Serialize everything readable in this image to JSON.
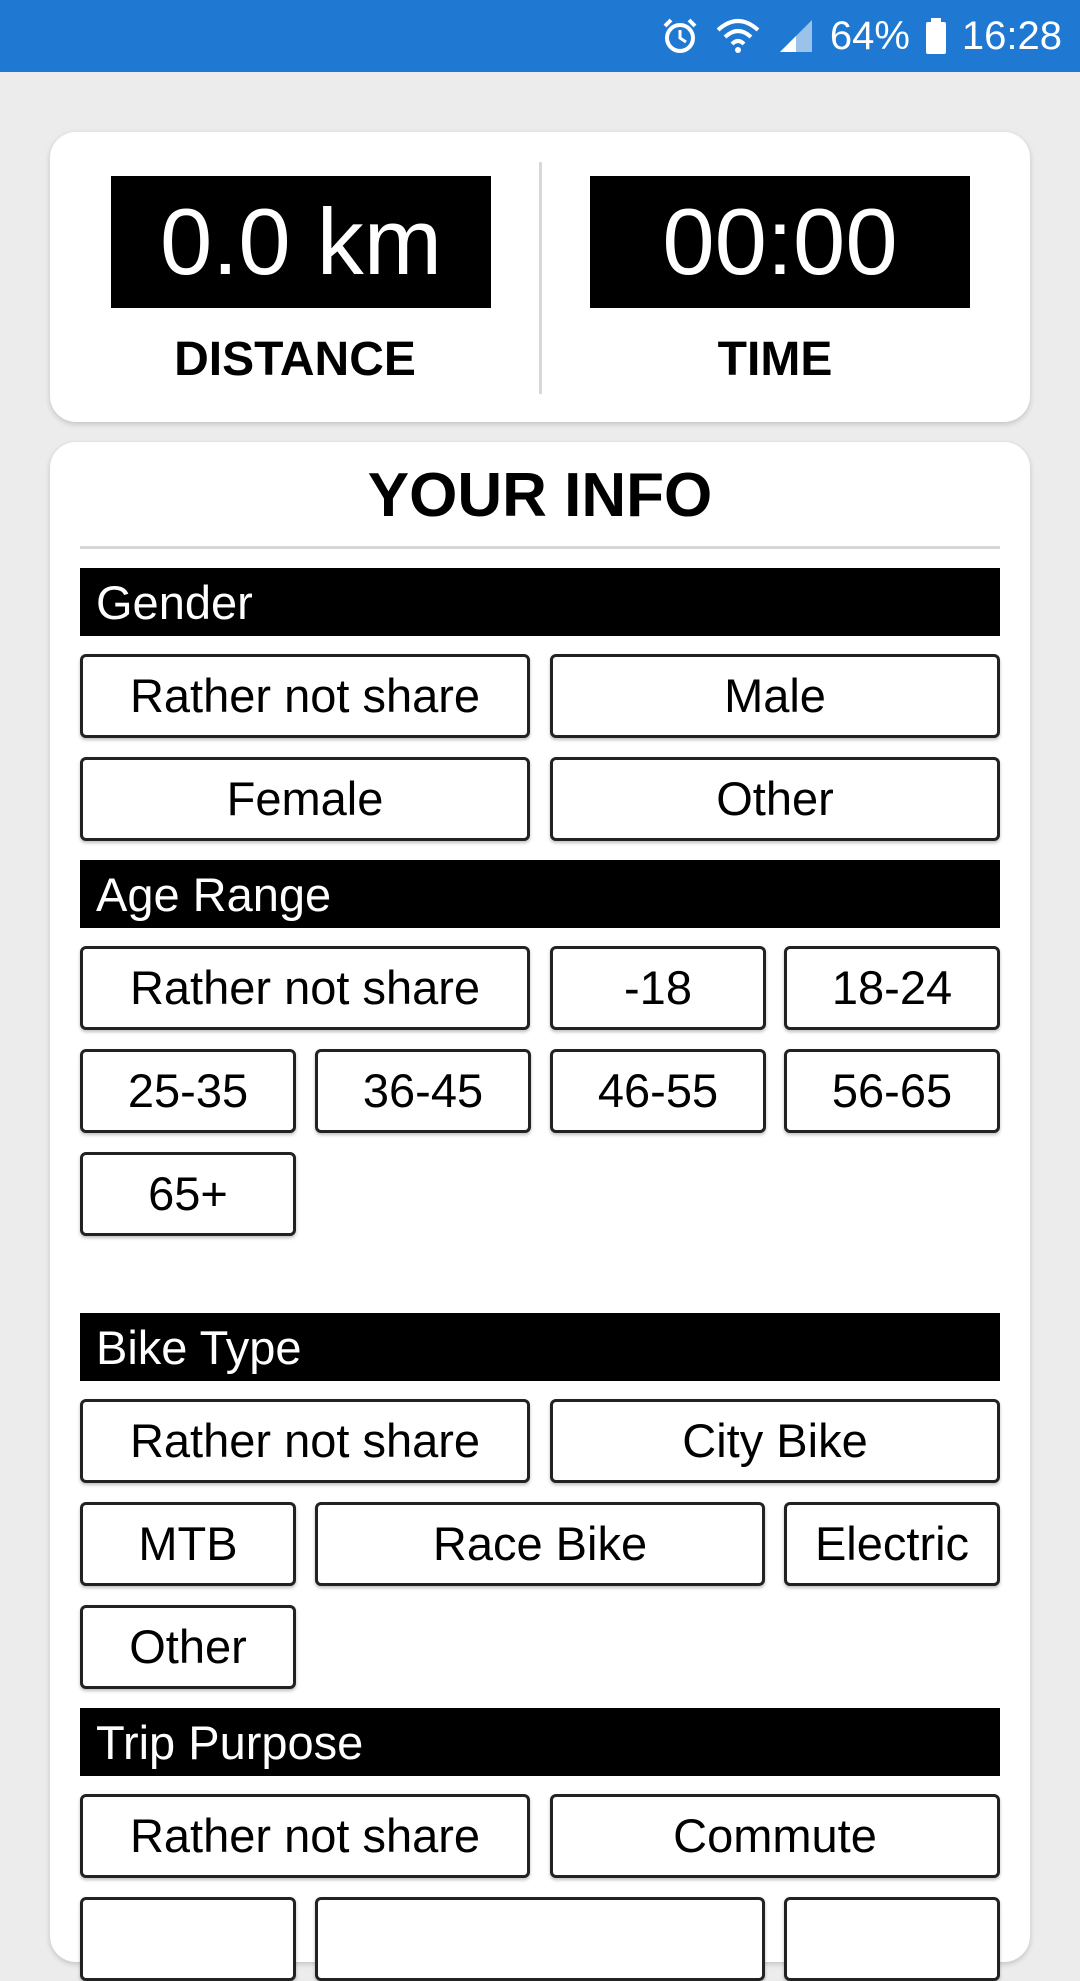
{
  "status_bar": {
    "battery_percent": "64%",
    "time": "16:28",
    "icons": [
      "alarm-icon",
      "wifi-icon",
      "signal-icon",
      "battery-icon"
    ]
  },
  "stats": {
    "distance_value": "0.0 km",
    "distance_label": "DISTANCE",
    "time_value": "00:00",
    "time_label": "TIME"
  },
  "info": {
    "title": "YOUR INFO",
    "gender": {
      "header": "Gender",
      "options": [
        "Rather not share",
        "Male",
        "Female",
        "Other"
      ]
    },
    "age": {
      "header": "Age Range",
      "options": [
        "Rather not share",
        "-18",
        "18-24",
        "25-35",
        "36-45",
        "46-55",
        "56-65",
        "65+"
      ]
    },
    "bike": {
      "header": "Bike Type",
      "options": [
        "Rather not share",
        "City Bike",
        "MTB",
        "Race Bike",
        "Electric",
        "Other"
      ]
    },
    "trip": {
      "header": "Trip Purpose",
      "options": [
        "Rather not share",
        "Commute"
      ]
    }
  }
}
